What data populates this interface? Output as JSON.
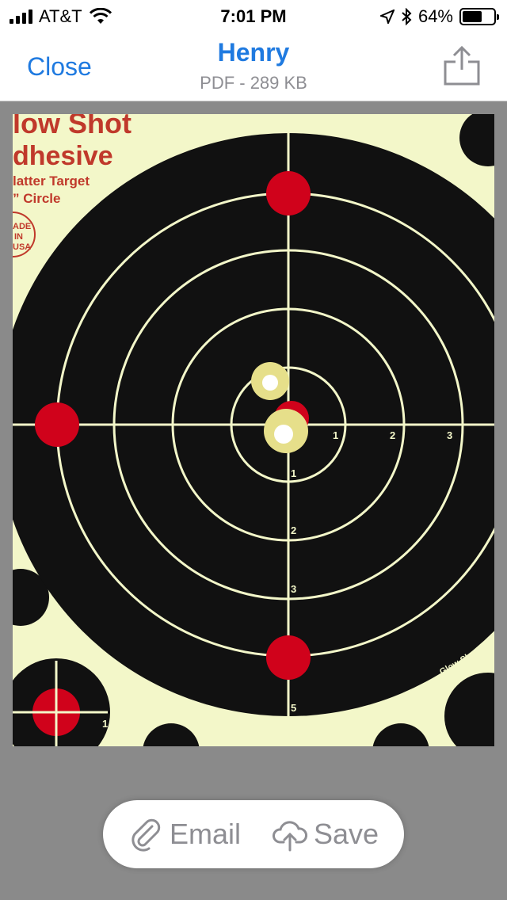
{
  "status": {
    "carrier": "AT&T",
    "time": "7:01 PM",
    "battery": "64%",
    "battery_level": 0.64,
    "icons": [
      "signal-icon",
      "wifi-icon",
      "location-icon",
      "bluetooth-icon",
      "battery-icon"
    ]
  },
  "nav": {
    "close_label": "Close",
    "title": "Henry",
    "subtitle": "PDF - 289 KB",
    "share_icon": "share-icon"
  },
  "target": {
    "brand_line1": "low Shot",
    "brand_line2": "dhesive",
    "brand_line3": "latter Target",
    "brand_line4": "” Circle",
    "badge_line1": "ADE",
    "badge_line2": "IN",
    "badge_line3": "USA",
    "footer_text": "Glow Shot Targ",
    "ring_labels_h": [
      "1",
      "2",
      "3"
    ],
    "ring_labels_v": [
      "1",
      "2",
      "3",
      "5"
    ],
    "corner_label": "1",
    "colors": {
      "background": "#f3f7c9",
      "ring": "#111111",
      "bullseye": "#d0021b",
      "line": "#f3f7c9"
    }
  },
  "actions": {
    "email_label": "Email",
    "save_label": "Save"
  }
}
